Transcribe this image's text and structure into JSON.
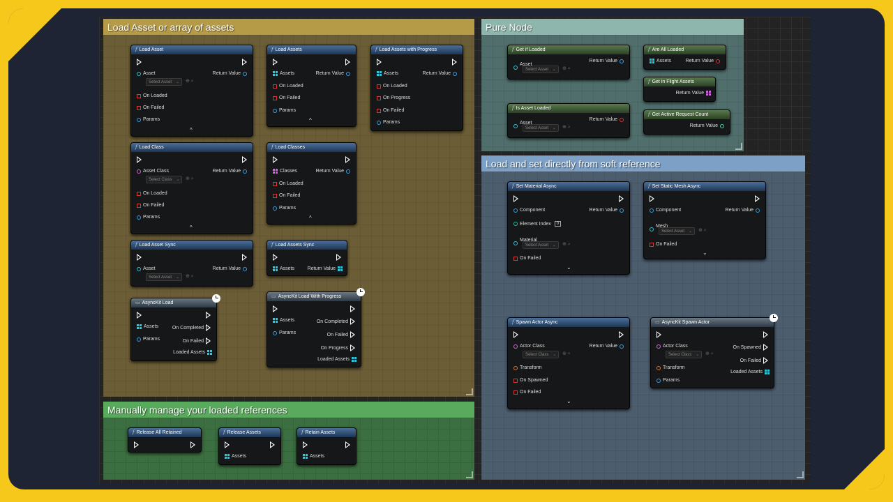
{
  "colors": {
    "accent": "#f7c81c",
    "background": "#1f2434"
  },
  "comments": [
    {
      "key": "load",
      "title": "Load Asset or array of assets"
    },
    {
      "key": "pure",
      "title": "Pure Node"
    },
    {
      "key": "soft",
      "title": "Load and set directly from soft reference"
    },
    {
      "key": "manual",
      "title": "Manually manage your loaded references"
    }
  ],
  "labels": {
    "asset": "Asset",
    "assets": "Assets",
    "return_value": "Return Value",
    "on_loaded": "On Loaded",
    "on_failed": "On Failed",
    "params": "Params",
    "on_progress": "On Progress",
    "asset_class": "Asset Class",
    "classes": "Classes",
    "select_asset": "Select Asset",
    "select_class": "Select Class",
    "on_completed": "On Completed",
    "loaded_assets": "Loaded Assets",
    "component": "Component",
    "element_index": "Element Index",
    "element_index_value": "0",
    "material": "Material",
    "mesh": "Mesh",
    "actor_class": "Actor Class",
    "transform": "Transform",
    "on_spawned": "On Spawned"
  },
  "nodes": {
    "load_asset": "Load Asset",
    "load_assets": "Load Assets",
    "load_assets_progress": "Load Assets with Progress",
    "load_class": "Load Class",
    "load_classes": "Load Classes",
    "load_asset_sync": "Load Asset Sync",
    "load_assets_sync": "Load Assets Sync",
    "asynckit_load": "AsyncKit Load",
    "asynckit_load_progress": "AsyncKit Load With Progress",
    "get_if_loaded": "Get if Loaded",
    "are_all_loaded": "Are All Loaded",
    "get_in_flight": "Get in Flight Assets",
    "is_asset_loaded": "Is Asset Loaded",
    "get_active_request_count": "Get Active Request Count",
    "set_material_async": "Set Material Async",
    "set_static_mesh_async": "Set Static Mesh Async",
    "spawn_actor_async": "Spawn Actor Async",
    "asynckit_spawn_actor": "AsyncKit Spawn Actor",
    "release_all_retained": "Release All Retained",
    "release_assets": "Release Assets",
    "retain_assets": "Retain Assets"
  },
  "icons": [
    "function-icon",
    "exec-pin-icon",
    "data-pin-icon",
    "array-pin-icon",
    "dropdown-icon",
    "clock-icon",
    "expand-caret-icon"
  ]
}
